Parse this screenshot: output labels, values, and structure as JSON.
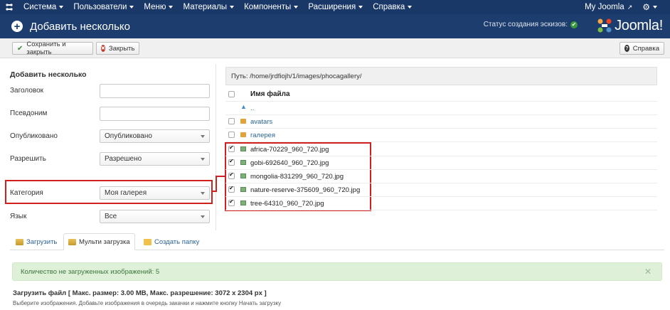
{
  "navbar": {
    "menu": [
      "Система",
      "Пользователи",
      "Меню",
      "Материалы",
      "Компоненты",
      "Расширения",
      "Справка"
    ],
    "my_joomla": "My Joomla"
  },
  "header": {
    "title": "Добавить несколько",
    "thumb_status": "Статус создания эскизов:",
    "brand": "Joomla!"
  },
  "toolbar": {
    "save_close": "Сохранить и закрыть",
    "close": "Закрыть",
    "help": "Справка"
  },
  "form": {
    "heading": "Добавить несколько",
    "title_label": "Заголовок",
    "title_value": "",
    "alias_label": "Псевдоним",
    "alias_value": "",
    "published_label": "Опубликовано",
    "published_value": "Опубликовано",
    "access_label": "Разрешить",
    "access_value": "Разрешено",
    "category_label": "Категория",
    "category_value": "Моя галерея",
    "language_label": "Язык",
    "language_value": "Все"
  },
  "browser": {
    "path": "Путь: /home/jrdfiojh/1/images/phocagallery/",
    "column_header": "Имя файла",
    "up": "..",
    "folders": [
      "avatars",
      "галерея"
    ],
    "files": [
      "africa-70229_960_720.jpg",
      "gobi-692640_960_720.jpg",
      "mongolia-831299_960_720.jpg",
      "nature-reserve-375609_960_720.jpg",
      "tree-64310_960_720.jpg"
    ]
  },
  "tabs": {
    "upload": "Загрузить",
    "multi_upload": "Мульти загрузка",
    "create_folder": "Создать папку"
  },
  "alert": {
    "text": "Количество не загруженных изображений: 5"
  },
  "upload": {
    "title": "Загрузить файл [ Макс. размер: 3.00 MB, Макс. разрешение: 3072 x 2304 px ]",
    "desc": "Выберите изображения. Добавьте изображения в очередь закачки и нажмите кнопку Начать загрузку"
  },
  "colors": {
    "navbar": "#1a3867",
    "header": "#1c3d6e",
    "highlight": "#d21f1f",
    "alert_bg": "#dff0d8",
    "link": "#2a6496"
  }
}
